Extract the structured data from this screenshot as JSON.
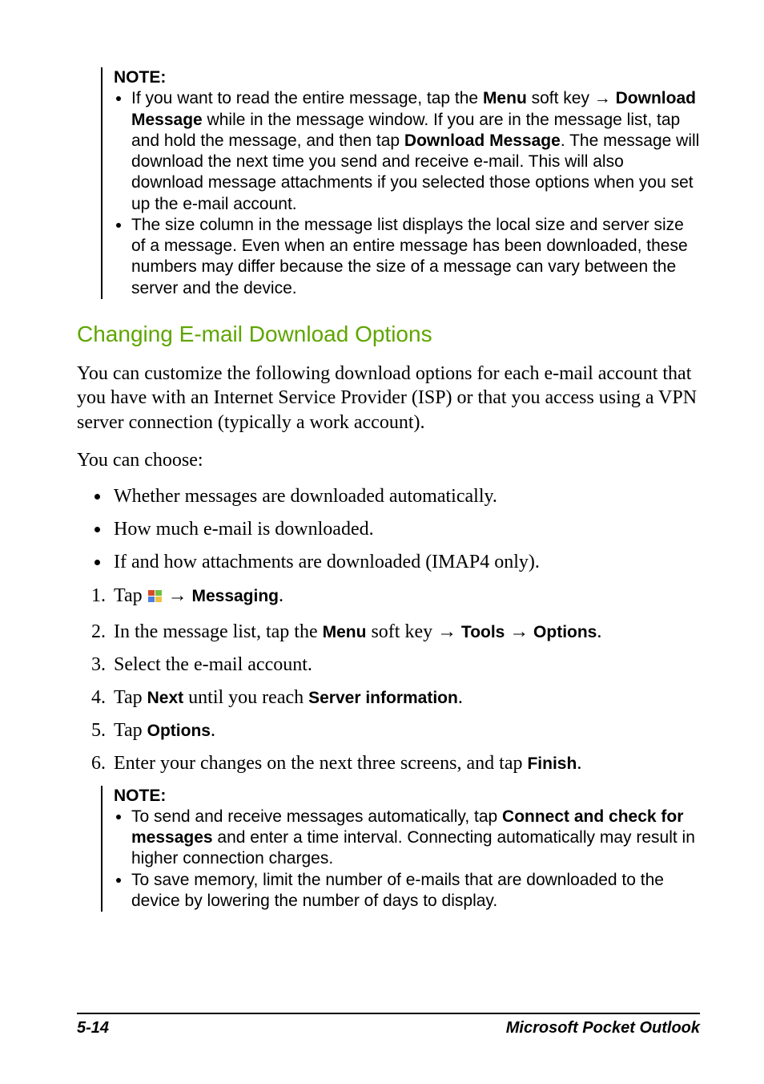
{
  "noteHead": "NOTE:",
  "note1": {
    "b1a": "If you want to read the entire message, tap the ",
    "b1_menu": "Menu",
    "b1b": " soft key ",
    "arrow": "→",
    "b1c": " ",
    "b1_download": "Download Message",
    "b1d": " while in the message window. If you are in the message list, tap and hold the message, and then tap ",
    "b1_download2": "Download Message",
    "b1e": ". The message will download the next time you send and receive e-mail. This will also download message attachments if you selected those options when you set up the e-mail account.",
    "b2": "The size column in the message list displays the local size and server size of a message. Even when an entire message has been downloaded, these numbers may differ because the size of a message can vary between the server and the device."
  },
  "heading": "Changing E-mail Download Options",
  "para1": "You can customize the following download options for each e-mail account that you have with an Internet Service Provider (ISP) or that you access using a VPN server connection (typically a work account).",
  "para2": "You can choose:",
  "bullets": {
    "b1": "Whether messages are downloaded automatically.",
    "b2": "How much e-mail is downloaded.",
    "b3": "If and how attachments are downloaded (IMAP4 only)."
  },
  "steps": {
    "s1a": "Tap ",
    "s1b": "  ",
    "arrow": "→",
    "s1_messaging": " Messaging",
    "s1_period": ".",
    "s2a": "In the message list, tap the ",
    "s2_menu": "Menu",
    "s2b": " soft key ",
    "s2_tools": " Tools ",
    "s2_options": " Options",
    "s2_period": ".",
    "s3": "Select the e-mail account.",
    "s4a": "Tap ",
    "s4_next": "Next",
    "s4b": " until you reach ",
    "s4_server": "Server information",
    "s4_period": ".",
    "s5a": "Tap ",
    "s5_options": "Options",
    "s5_period": ".",
    "s6a": "Enter your changes on the next three screens, and tap ",
    "s6_finish": "Finish",
    "s6_period": "."
  },
  "note2": {
    "b1a": "To send and receive messages automatically, tap ",
    "b1_connect": "Connect and check for messages",
    "b1b": " and enter a time interval. Connecting automatically may result in higher connection charges.",
    "b2": "To save memory, limit the number of e-mails that are downloaded to the device by lowering the number of days to display."
  },
  "footer": {
    "left": "5-14",
    "right": "Microsoft Pocket Outlook"
  }
}
